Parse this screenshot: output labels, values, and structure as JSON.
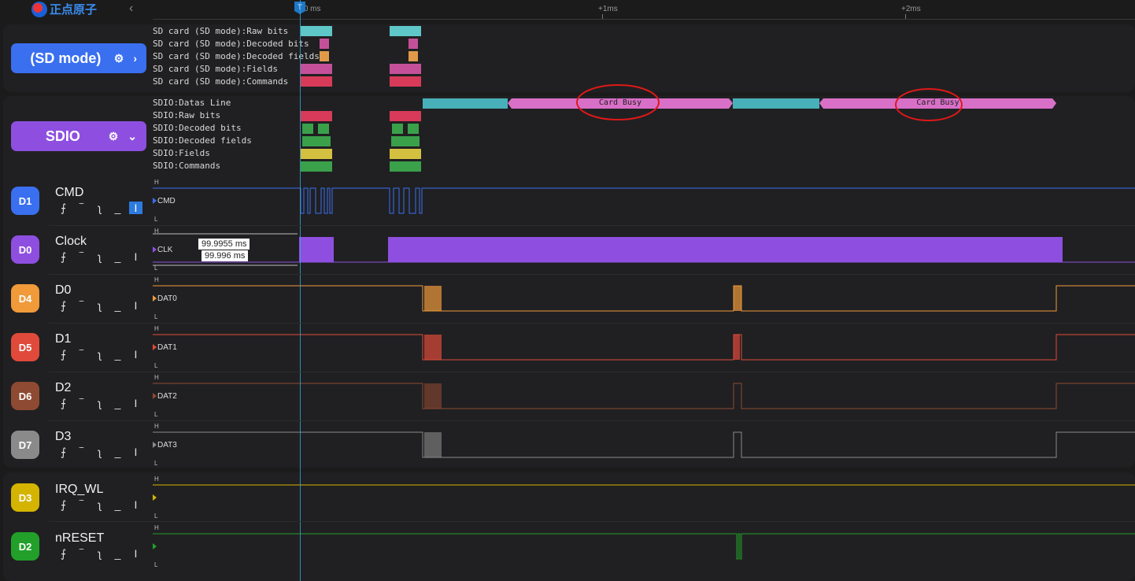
{
  "app": {
    "logo_text": "正点原子",
    "collapse_icon": "chevron-left-icon"
  },
  "ruler": {
    "marker": "T",
    "ticks": [
      "+0 ms",
      "+1ms",
      "+2ms"
    ]
  },
  "groups": [
    {
      "label": "(SD mode)",
      "color": "#3a6ff0",
      "expand_icon": "chevron-right-icon",
      "decoders": [
        "SD card (SD mode):Raw bits",
        "SD card (SD mode):Decoded bits",
        "SD card (SD mode):Decoded fields",
        "SD card (SD mode):Fields",
        "SD card (SD mode):Commands"
      ]
    },
    {
      "label": "SDIO",
      "color": "#8e4fe0",
      "expand_icon": "chevron-down-icon",
      "decoders": [
        "SDIO:Datas Line",
        "SDIO:Raw bits",
        "SDIO:Decoded bits",
        "SDIO:Decoded fields",
        "SDIO:Fields",
        "SDIO:Commands"
      ]
    }
  ],
  "busy_labels": [
    "Card Busy",
    "Card Busy"
  ],
  "channels": [
    {
      "badge": "D1",
      "name": "CMD",
      "signal": "CMD",
      "color": "#3a6ff0"
    },
    {
      "badge": "D0",
      "name": "Clock",
      "signal": "CLK",
      "color": "#8e4fe0"
    },
    {
      "badge": "D4",
      "name": "D0",
      "signal": "DAT0",
      "color": "#f09a3a"
    },
    {
      "badge": "D5",
      "name": "D1",
      "signal": "DAT1",
      "color": "#e04a3a"
    },
    {
      "badge": "D6",
      "name": "D2",
      "signal": "DAT2",
      "color": "#8e4a32"
    },
    {
      "badge": "D7",
      "name": "D3",
      "signal": "DAT3",
      "color": "#8a8a8a"
    },
    {
      "badge": "D3",
      "name": "IRQ_WL",
      "signal": "",
      "color": "#d4b400"
    },
    {
      "badge": "D2",
      "name": "nRESET",
      "signal": "",
      "color": "#22a02a"
    }
  ],
  "level_labels": {
    "high": "H",
    "low": "L"
  },
  "measurements": [
    "99.9955 ms",
    "99.996 ms"
  ],
  "trigger_icons": [
    "rising-edge-icon",
    "high-level-icon",
    "falling-edge-icon",
    "low-level-icon",
    "any-edge-icon"
  ]
}
